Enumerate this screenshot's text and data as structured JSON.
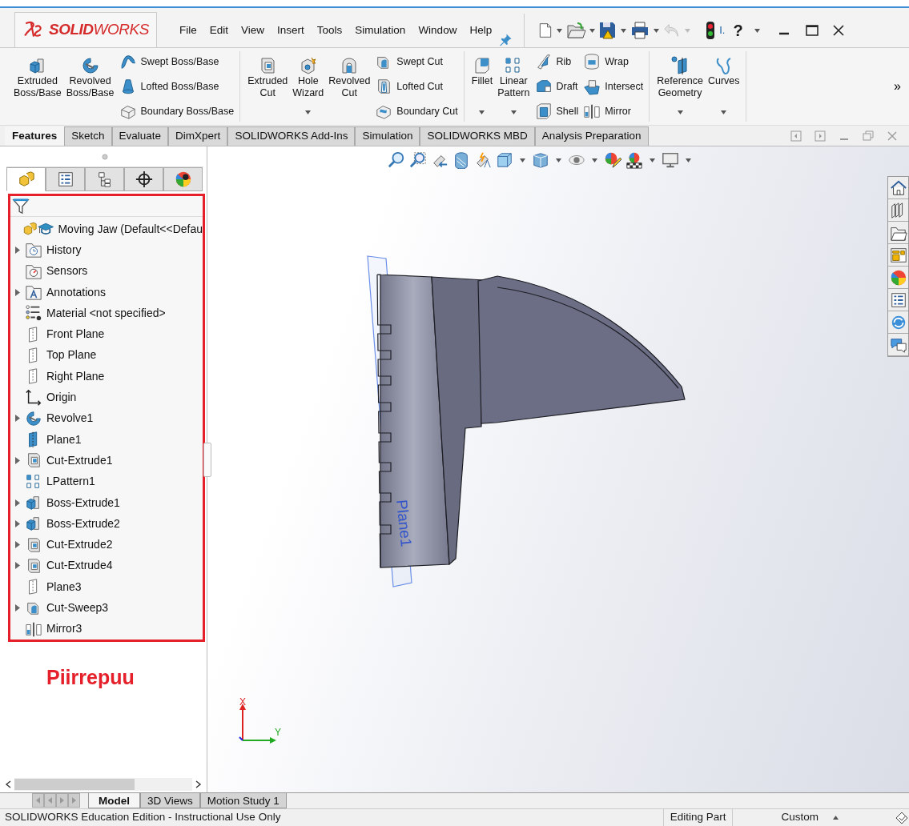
{
  "title_bar": {
    "logo": "**SOLID**WORKS",
    "menu": [
      "File",
      "Edit",
      "View",
      "Insert",
      "Tools",
      "Simulation",
      "Window",
      "Help"
    ],
    "user_label": "I.",
    "help": "?"
  },
  "ribbon": {
    "groups": [
      {
        "tools": [
          {
            "kind": "large",
            "label": "Extruded\nBoss/Base",
            "dropdown": false
          },
          {
            "kind": "large",
            "label": "Revolved\nBoss/Base",
            "dropdown": false
          },
          {
            "kind": "stack",
            "items": [
              "Swept Boss/Base",
              "Lofted Boss/Base",
              "Boundary Boss/Base"
            ]
          }
        ]
      },
      {
        "tools": [
          {
            "kind": "large",
            "label": "Extruded\nCut",
            "dropdown": false
          },
          {
            "kind": "large",
            "label": "Hole\nWizard",
            "dropdown": true
          },
          {
            "kind": "large",
            "label": "Revolved\nCut",
            "dropdown": false
          },
          {
            "kind": "stack",
            "items": [
              "Swept Cut",
              "Lofted Cut",
              "Boundary Cut"
            ]
          }
        ]
      },
      {
        "tools": [
          {
            "kind": "large",
            "label": "Fillet",
            "dropdown": true
          },
          {
            "kind": "large",
            "label": "Linear\nPattern",
            "dropdown": true
          },
          {
            "kind": "stack",
            "items": [
              "Rib",
              "Draft",
              "Shell"
            ]
          },
          {
            "kind": "stack",
            "items": [
              "Wrap",
              "Intersect",
              "Mirror"
            ]
          }
        ]
      },
      {
        "tools": [
          {
            "kind": "large",
            "label": "Reference\nGeometry",
            "dropdown": true
          },
          {
            "kind": "large",
            "label": "Curves",
            "dropdown": true
          }
        ]
      }
    ],
    "overflow": "»"
  },
  "command_tabs": [
    {
      "label": "Features",
      "selected": true
    },
    {
      "label": "Sketch",
      "selected": false
    },
    {
      "label": "Evaluate",
      "selected": false
    },
    {
      "label": "DimXpert",
      "selected": false
    },
    {
      "label": "SOLIDWORKS Add-Ins",
      "selected": false
    },
    {
      "label": "Simulation",
      "selected": false
    },
    {
      "label": "SOLIDWORKS MBD",
      "selected": false
    },
    {
      "label": "Analysis Preparation",
      "selected": false
    }
  ],
  "panel_tabs": [
    {
      "selected": true
    },
    {
      "selected": false
    },
    {
      "selected": false
    },
    {
      "selected": false
    },
    {
      "selected": false
    }
  ],
  "feature_tree": [
    {
      "kind": "part",
      "label": "Moving Jaw  (Default<<Defau",
      "expandable": false
    },
    {
      "kind": "history",
      "label": "History",
      "expandable": true
    },
    {
      "kind": "sensors",
      "label": "Sensors",
      "expandable": false
    },
    {
      "kind": "annotations",
      "label": "Annotations",
      "expandable": true
    },
    {
      "kind": "material",
      "label": "Material <not specified>",
      "expandable": false
    },
    {
      "kind": "plane",
      "label": "Front Plane",
      "expandable": false
    },
    {
      "kind": "plane",
      "label": "Top Plane",
      "expandable": false
    },
    {
      "kind": "plane",
      "label": "Right Plane",
      "expandable": false
    },
    {
      "kind": "origin",
      "label": "Origin",
      "expandable": false
    },
    {
      "kind": "revolve",
      "label": "Revolve1",
      "expandable": true
    },
    {
      "kind": "refplane",
      "label": "Plane1",
      "expandable": false
    },
    {
      "kind": "cut",
      "label": "Cut-Extrude1",
      "expandable": true
    },
    {
      "kind": "pattern",
      "label": "LPattern1",
      "expandable": false
    },
    {
      "kind": "boss",
      "label": "Boss-Extrude1",
      "expandable": true
    },
    {
      "kind": "boss",
      "label": "Boss-Extrude2",
      "expandable": true
    },
    {
      "kind": "cut",
      "label": "Cut-Extrude2",
      "expandable": true
    },
    {
      "kind": "cut",
      "label": "Cut-Extrude4",
      "expandable": true
    },
    {
      "kind": "plane",
      "label": "Plane3",
      "expandable": false
    },
    {
      "kind": "sweep",
      "label": "Cut-Sweep3",
      "expandable": true
    },
    {
      "kind": "mirror",
      "label": "Mirror3",
      "expandable": false
    }
  ],
  "annotation": {
    "label": "Piirrepuu"
  },
  "viewport": {
    "plane_label": "Plane1",
    "triad": {
      "x_label": "X",
      "y_label": "Y"
    }
  },
  "bottom_tabs": [
    {
      "label": "Model",
      "selected": true
    },
    {
      "label": "3D Views",
      "selected": false
    },
    {
      "label": "Motion Study 1",
      "selected": false
    }
  ],
  "status_bar": {
    "message": "SOLIDWORKS Education Edition - Instructional Use Only",
    "mode": "Editing Part",
    "units": "Custom"
  }
}
